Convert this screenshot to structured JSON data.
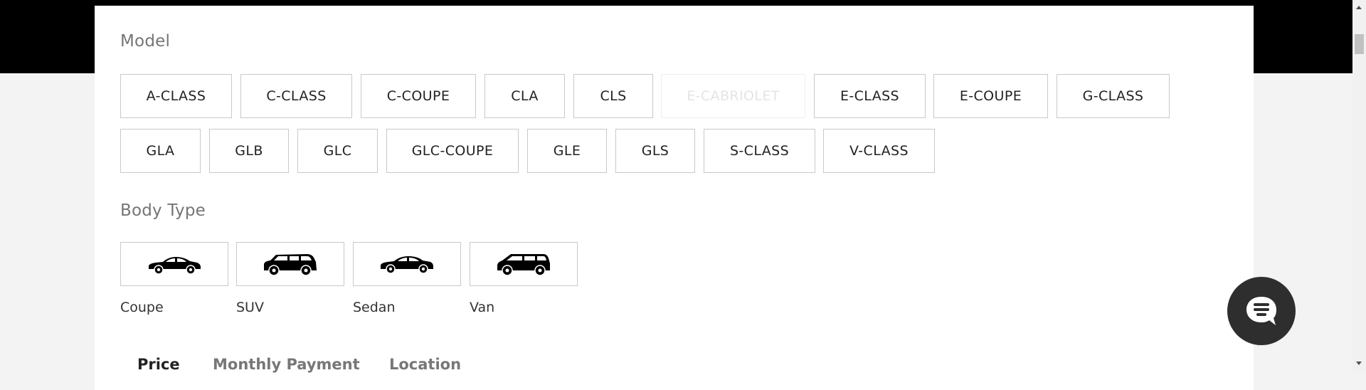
{
  "filters": {
    "model_title": "Model",
    "models": [
      {
        "label": "A-CLASS",
        "disabled": false
      },
      {
        "label": "C-CLASS",
        "disabled": false
      },
      {
        "label": "C-COUPE",
        "disabled": false
      },
      {
        "label": "CLA",
        "disabled": false
      },
      {
        "label": "CLS",
        "disabled": false
      },
      {
        "label": "E-CABRIOLET",
        "disabled": true
      },
      {
        "label": "E-CLASS",
        "disabled": false
      },
      {
        "label": "E-COUPE",
        "disabled": false
      },
      {
        "label": "G-CLASS",
        "disabled": false
      },
      {
        "label": "GLA",
        "disabled": false
      },
      {
        "label": "GLB",
        "disabled": false
      },
      {
        "label": "GLC",
        "disabled": false
      },
      {
        "label": "GLC-COUPE",
        "disabled": false
      },
      {
        "label": "GLE",
        "disabled": false
      },
      {
        "label": "GLS",
        "disabled": false
      },
      {
        "label": "S-CLASS",
        "disabled": false
      },
      {
        "label": "V-CLASS",
        "disabled": false
      }
    ],
    "body_type_title": "Body Type",
    "body_types": [
      {
        "label": "Coupe",
        "icon": "coupe-car-icon"
      },
      {
        "label": "SUV",
        "icon": "suv-car-icon"
      },
      {
        "label": "Sedan",
        "icon": "sedan-car-icon"
      },
      {
        "label": "Van",
        "icon": "van-car-icon"
      }
    ],
    "tabs": [
      {
        "label": "Price",
        "active": true
      },
      {
        "label": "Monthly Payment",
        "active": false
      },
      {
        "label": "Location",
        "active": false
      }
    ]
  },
  "chat": {
    "icon": "chat-icon"
  },
  "colors": {
    "accent_dark": "#2e2e2e",
    "border": "#c9c9c9",
    "header": "#000000"
  }
}
